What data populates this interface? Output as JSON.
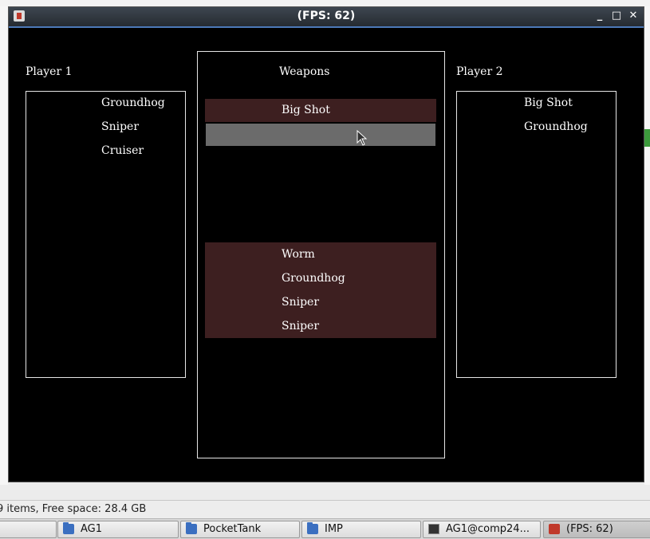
{
  "window": {
    "title": "(FPS: 62)",
    "controls": {
      "minimize": "_",
      "maximize": "□",
      "close": "✕"
    }
  },
  "game": {
    "player1": {
      "label": "Player 1",
      "weapons": [
        "Groundhog",
        "Sniper",
        "Cruiser"
      ]
    },
    "center": {
      "label": "Weapons",
      "selected": [
        "Big Shot"
      ],
      "available": [
        "Worm",
        "Groundhog",
        "Sniper",
        "Sniper"
      ]
    },
    "player2": {
      "label": "Player 2",
      "weapons": [
        "Big Shot",
        "Groundhog"
      ]
    }
  },
  "status_bar": {
    "text": "9 items, Free space: 28.4 GB"
  },
  "taskbar": {
    "items": [
      {
        "label": "AG1",
        "icon": "folder-icon"
      },
      {
        "label": "PocketTank",
        "icon": "folder-icon"
      },
      {
        "label": "IMP",
        "icon": "folder-icon"
      },
      {
        "label": "AG1@comp24...",
        "icon": "terminal-icon"
      },
      {
        "label": "(FPS: 62)",
        "icon": "java-icon"
      }
    ]
  },
  "colors": {
    "game_background": "#000000",
    "highlight_row": "#3d1f20",
    "hover_row": "#6b6b6b",
    "panel_border": "#e6e6e6",
    "titlebar": "#2f353c"
  }
}
